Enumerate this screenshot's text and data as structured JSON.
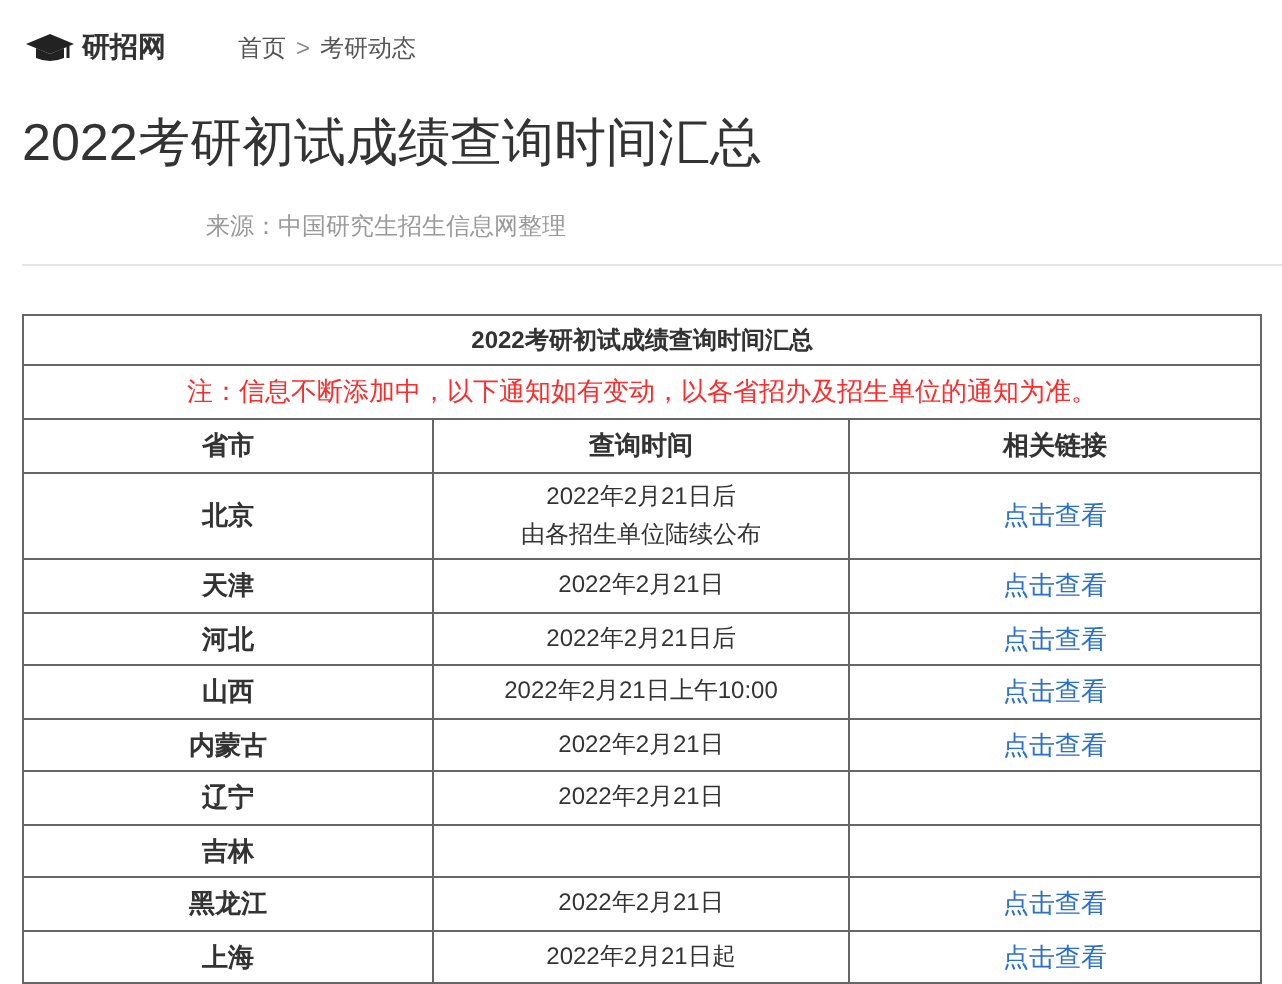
{
  "site": {
    "logo_text": "研招网"
  },
  "breadcrumb": [
    "首页",
    "考研动态"
  ],
  "breadcrumb_separator": ">",
  "title": "2022考研初试成绩查询时间汇总",
  "source": "来源：中国研究生招生信息网整理",
  "table": {
    "caption": "2022考研初试成绩查询时间汇总",
    "note": "注：信息不断添加中，以下通知如有变动，以各省招办及招生单位的通知为准。",
    "columns": [
      "省市",
      "查询时间",
      "相关链接"
    ],
    "rows": [
      {
        "province": "北京",
        "time": [
          "2022年2月21日后",
          "由各招生单位陆续公布"
        ],
        "link": "点击查看"
      },
      {
        "province": "天津",
        "time": [
          "2022年2月21日"
        ],
        "link": "点击查看"
      },
      {
        "province": "河北",
        "time": [
          "2022年2月21日后"
        ],
        "link": "点击查看"
      },
      {
        "province": "山西",
        "time": [
          "2022年2月21日上午10:00"
        ],
        "link": "点击查看"
      },
      {
        "province": "内蒙古",
        "time": [
          "2022年2月21日"
        ],
        "link": "点击查看"
      },
      {
        "province": "辽宁",
        "time": [
          "2022年2月21日"
        ]
      },
      {
        "province": "吉林"
      },
      {
        "province": "黑龙江",
        "time": [
          "2022年2月21日"
        ],
        "link": "点击查看"
      },
      {
        "province": "上海",
        "time": [
          "2022年2月21日起"
        ],
        "link": "点击查看"
      }
    ]
  }
}
